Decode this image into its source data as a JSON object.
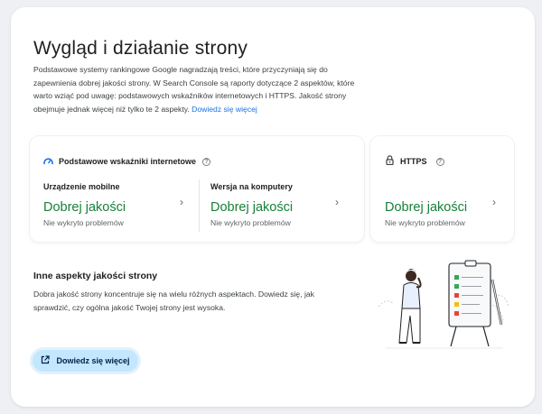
{
  "section": {
    "title": "Wygląd i działanie strony",
    "intro": "Podstawowe systemy rankingowe Google nagradzają treści, które przyczyniają się do zapewnienia dobrej jakości strony. W Search Console są raporty dotyczące 2 aspektów, które warto wziąć pod uwagę: podstawowych wskaźników internetowych i HTTPS. Jakość strony obejmuje jednak więcej niż tylko te 2 aspekty.",
    "intro_link": "Dowiedz się więcej"
  },
  "cwv": {
    "title": "Podstawowe wskaźniki internetowe",
    "mobile": {
      "label": "Urządzenie mobilne",
      "value": "Dobrej jakości",
      "sub": "Nie wykryto problemów"
    },
    "desktop": {
      "label": "Wersja na komputery",
      "value": "Dobrej jakości",
      "sub": "Nie wykryto problemów"
    }
  },
  "https": {
    "title": "HTTPS",
    "value": "Dobrej jakości",
    "sub": "Nie wykryto problemów"
  },
  "other": {
    "title": "Inne aspekty jakości strony",
    "desc": "Dobra jakość strony koncentruje się na wielu różnych aspektach. Dowiedz się, jak sprawdzić, czy ogólna jakość Twojej strony jest wysoka.",
    "button": "Dowiedz się więcej"
  },
  "colors": {
    "good": "#188038",
    "link": "#1a73e8",
    "button_bg": "#c2e7ff"
  },
  "icons": [
    "speedometer-icon",
    "help-icon",
    "lock-icon",
    "chevron-right-icon",
    "open-external-icon"
  ]
}
